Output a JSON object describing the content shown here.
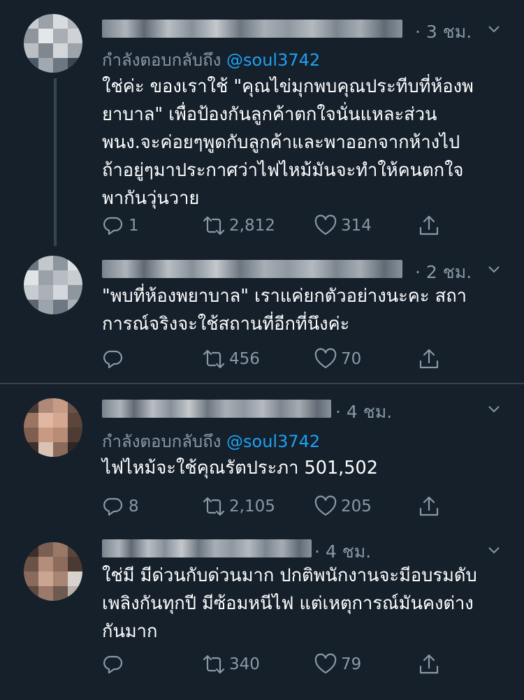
{
  "tweets": [
    {
      "time": "· 3 ชม.",
      "reply_prefix": "กำลังตอบกลับถึง",
      "reply_handle": "@soul3742",
      "lines": [
        "ใช่ค่ะ ของเราใช้ \"คุณไข่มุกพบคุณประทีบที่ห้องพ",
        "ยาบาล\" เพื่อป้องกันลูกค้าตกใจนั่นแหละส่วน",
        "พนง.จะค่อยๆพูดกับลูกค้าและพาออกจากห้างไป",
        "ถ้าอยู่ๆมาประกาศว่าไฟไหม้มันจะทำให้คนตกใจ",
        "พากันวุ่นวาย"
      ],
      "replies": "1",
      "retweets": "2,812",
      "likes": "314"
    },
    {
      "time": "· 2 ชม.",
      "lines": [
        "\"พบที่ห้องพยาบาล\" เราแค่ยกตัวอย่างนะคะ สถา",
        "การณ์จริงจะใช้สถานที่อีกที่นึงค่ะ"
      ],
      "replies": "",
      "retweets": "456",
      "likes": "70"
    },
    {
      "time": "· 4 ชม.",
      "reply_prefix": "กำลังตอบกลับถึง",
      "reply_handle": "@soul3742",
      "lines": [
        "ไฟไหม้จะใช้คุณรัตประภา 501,502"
      ],
      "replies": "8",
      "retweets": "2,105",
      "likes": "205"
    },
    {
      "time": "· 4 ชม.",
      "lines": [
        "ใช่มี มีด่วนกับด่วนมาก ปกติพนักงานจะมีอบรมดับ",
        "เพลิงกันทุกปี มีซ้อมหนีไฟ แต่เหตุการณ์มันคงต่าง",
        "กันมาก"
      ],
      "replies": "",
      "retweets": "340",
      "likes": "79"
    }
  ],
  "colors": {
    "background": "#15202b",
    "text": "#ffffff",
    "muted": "#8899a6",
    "link": "#1da1f2",
    "divider": "#38444d"
  },
  "icons": [
    "reply-icon",
    "retweet-icon",
    "like-icon",
    "share-icon",
    "chevron-down-icon"
  ]
}
